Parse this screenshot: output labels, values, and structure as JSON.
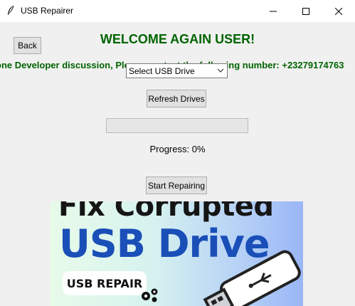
{
  "window": {
    "title": "USB Repairer",
    "controls": {
      "minimize": "—",
      "maximize": "☐",
      "close": "✕"
    }
  },
  "header": {
    "back_label": "Back",
    "welcome": "WELCOME AGAIN USER!",
    "marquee": "one Developer discussion, Please contact the following number: +23279174763"
  },
  "drive_select": {
    "selected": "Select USB Drive"
  },
  "buttons": {
    "refresh": "Refresh Drives",
    "start": "Start Repairing"
  },
  "progress": {
    "label": "Progress: 0%",
    "value": 0
  },
  "banner": {
    "line1": "Fix Corrupted",
    "line2": "USB Drive",
    "pill": "USB REPAIR"
  },
  "colors": {
    "accent_green": "#006400",
    "banner_blue": "#1a4fb8"
  }
}
